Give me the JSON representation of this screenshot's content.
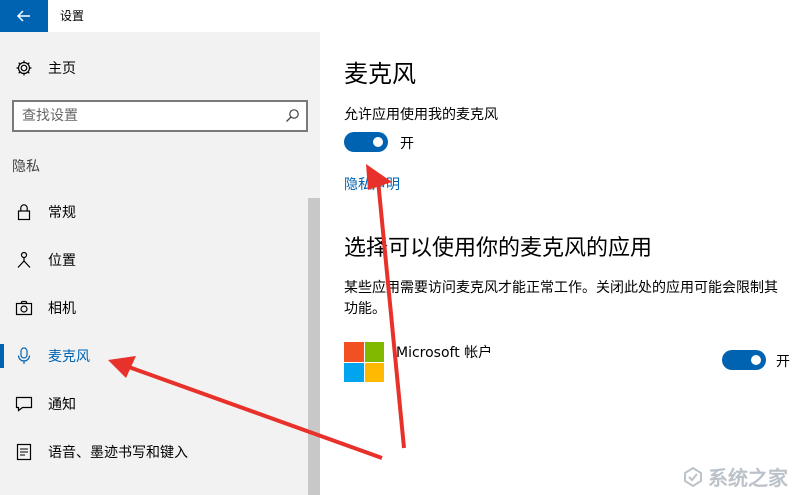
{
  "window": {
    "title": "设置",
    "back_icon": "arrow-left-icon"
  },
  "sidebar": {
    "home_label": "主页",
    "search_placeholder": "查找设置",
    "section_label": "隐私",
    "items": [
      {
        "label": "常规",
        "icon": "lock-icon",
        "active": false
      },
      {
        "label": "位置",
        "icon": "location-person-icon",
        "active": false
      },
      {
        "label": "相机",
        "icon": "camera-icon",
        "active": false
      },
      {
        "label": "麦克风",
        "icon": "microphone-icon",
        "active": true
      },
      {
        "label": "通知",
        "icon": "notification-icon",
        "active": false
      },
      {
        "label": "语音、墨迹书写和键入",
        "icon": "speech-ink-icon",
        "active": false
      }
    ]
  },
  "main": {
    "title": "麦克风",
    "allow_label": "允许应用使用我的麦克风",
    "toggle_state": "开",
    "toggle_on": true,
    "privacy_link": "隐私声明",
    "section_title": "选择可以使用你的麦克风的应用",
    "description": "某些应用需要访问麦克风才能正常工作。关闭此处的应用可能会限制其功能。",
    "apps": [
      {
        "name": "Microsoft 帐户",
        "toggle_state": "开",
        "toggle_on": true
      }
    ]
  },
  "watermark": {
    "text": "系统之家"
  },
  "colors": {
    "accent": "#0063b1",
    "annotation_arrow": "#e8312a"
  }
}
